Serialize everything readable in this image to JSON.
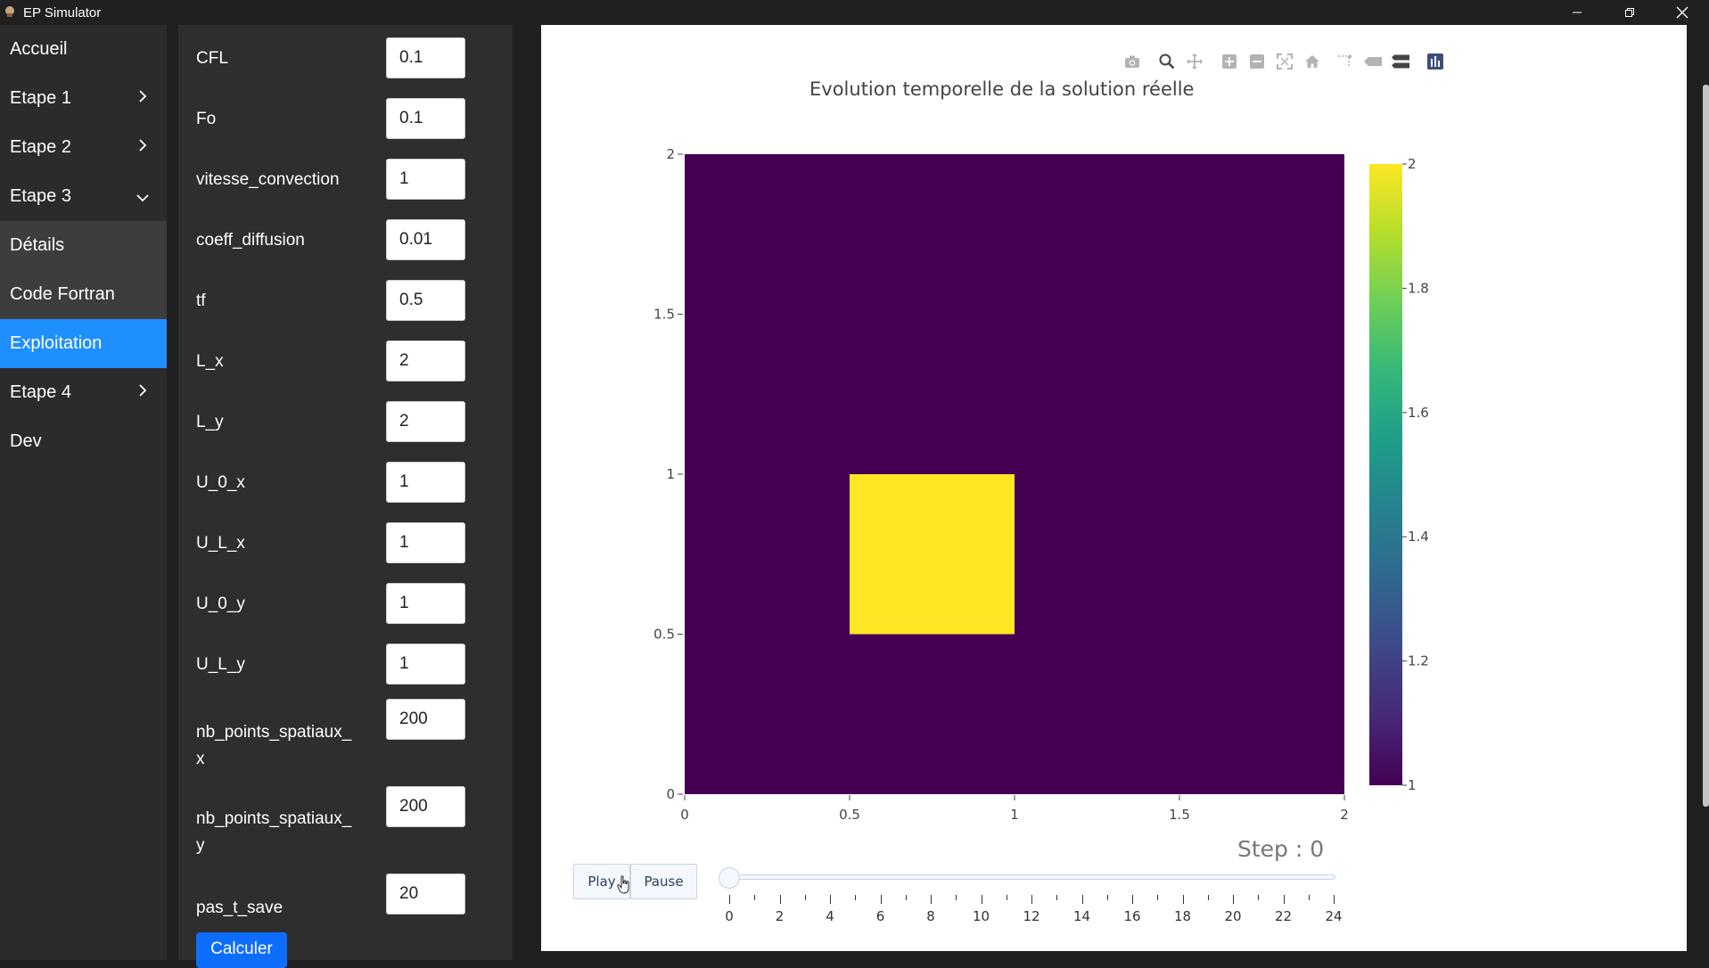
{
  "window": {
    "title": "EP Simulator",
    "minimize_icon": "minimize-icon",
    "restore_icon": "restore-icon",
    "close_icon": "close-icon"
  },
  "sidebar": {
    "items": [
      {
        "label": "Accueil",
        "chevron": null
      },
      {
        "label": "Etape 1",
        "chevron": "right"
      },
      {
        "label": "Etape 2",
        "chevron": "right"
      },
      {
        "label": "Etape 3",
        "chevron": "down"
      },
      {
        "label": "Détails",
        "chevron": null,
        "sub": true
      },
      {
        "label": "Code Fortran",
        "chevron": null,
        "sub": true
      },
      {
        "label": "Exploitation",
        "chevron": null,
        "sub": true,
        "active": true
      },
      {
        "label": "Etape 4",
        "chevron": "right"
      },
      {
        "label": "Dev",
        "chevron": null
      }
    ],
    "active_color": "#1f8fff"
  },
  "params": {
    "fields": [
      {
        "label": "CFL",
        "value": "0.1"
      },
      {
        "label": "Fo",
        "value": "0.1"
      },
      {
        "label": "vitesse_convection",
        "value": "1"
      },
      {
        "label": "coeff_diffusion",
        "value": "0.01"
      },
      {
        "label": "tf",
        "value": "0.5"
      },
      {
        "label": "L_x",
        "value": "2"
      },
      {
        "label": "L_y",
        "value": "2"
      },
      {
        "label": "U_0_x",
        "value": "1"
      },
      {
        "label": "U_L_x",
        "value": "1"
      },
      {
        "label": "U_0_y",
        "value": "1"
      },
      {
        "label": "U_L_y",
        "value": "1"
      },
      {
        "label": "nb_points_spatiaux_",
        "label2": "x",
        "value": "200"
      },
      {
        "label": "nb_points_spatiaux_",
        "label2": "y",
        "value": "200"
      },
      {
        "label": "pas_t_save",
        "value": "20"
      }
    ],
    "submit_label": "Calculer",
    "submit_color": "#0d6efd"
  },
  "modebar": [
    "camera-icon",
    "zoom-icon",
    "pan-icon",
    "zoom-in-icon",
    "zoom-out-icon",
    "autoscale-icon",
    "reset-axes-icon",
    "spike-lines-icon",
    "hover-closest-icon",
    "hover-compare-icon",
    "plotly-logo-icon"
  ],
  "chart_data": {
    "type": "heatmap",
    "title": "Evolution temporelle de la solution réelle",
    "xlim": [
      0,
      2
    ],
    "ylim": [
      0,
      2
    ],
    "x_ticks": [
      "0",
      "0.5",
      "1",
      "1.5",
      "2"
    ],
    "y_ticks": [
      "0",
      "0.5",
      "1",
      "1.5",
      "2"
    ],
    "background_value": 1,
    "regions": [
      {
        "x": [
          0.5,
          1
        ],
        "y": [
          0.5,
          1
        ],
        "value": 2
      }
    ],
    "colorscale": "Viridis",
    "colorbar": {
      "range": [
        1,
        2
      ],
      "ticks": [
        "1",
        "1.2",
        "1.4",
        "1.6",
        "1.8",
        "2"
      ]
    },
    "low_color": "#440154",
    "high_color": "#fde725",
    "grid": false,
    "legend": "none"
  },
  "animation": {
    "play_label": "Play",
    "pause_label": "Pause",
    "step_prefix": "Step : ",
    "step_value": "0",
    "step_display": "Step : 0",
    "slider_labels": [
      "0",
      "2",
      "4",
      "6",
      "8",
      "10",
      "12",
      "14",
      "16",
      "18",
      "20",
      "22",
      "24"
    ],
    "slider_max": 25,
    "slider_value": 0
  }
}
